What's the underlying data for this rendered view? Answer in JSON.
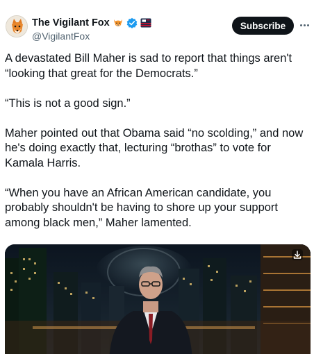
{
  "header": {
    "display_name": "The Vigilant Fox",
    "handle": "@VigilantFox",
    "subscribe_label": "Subscribe",
    "icons": [
      "fox-emoji-icon",
      "verified-badge-icon",
      "affiliate-flag-icon",
      "more-options-icon"
    ]
  },
  "tweet": {
    "paragraphs": [
      "A devastated Bill Maher is sad to report that things aren't “looking that great for the Democrats.”",
      "“This is not a good sign.”",
      "Maher pointed out that Obama said “no scolding,” and now he's doing exactly that, lecturing “brothas” to vote for Kamala Harris.",
      "“When you have an African American candidate, you probably shouldn't be having to shore up your support among black men,” Maher lamented."
    ]
  },
  "media": {
    "type": "video",
    "icon": "download-icon"
  },
  "colors": {
    "text_primary": "#0f1419",
    "text_secondary": "#536471",
    "verified_blue": "#1d9bf0",
    "button_bg": "#0f1419"
  }
}
